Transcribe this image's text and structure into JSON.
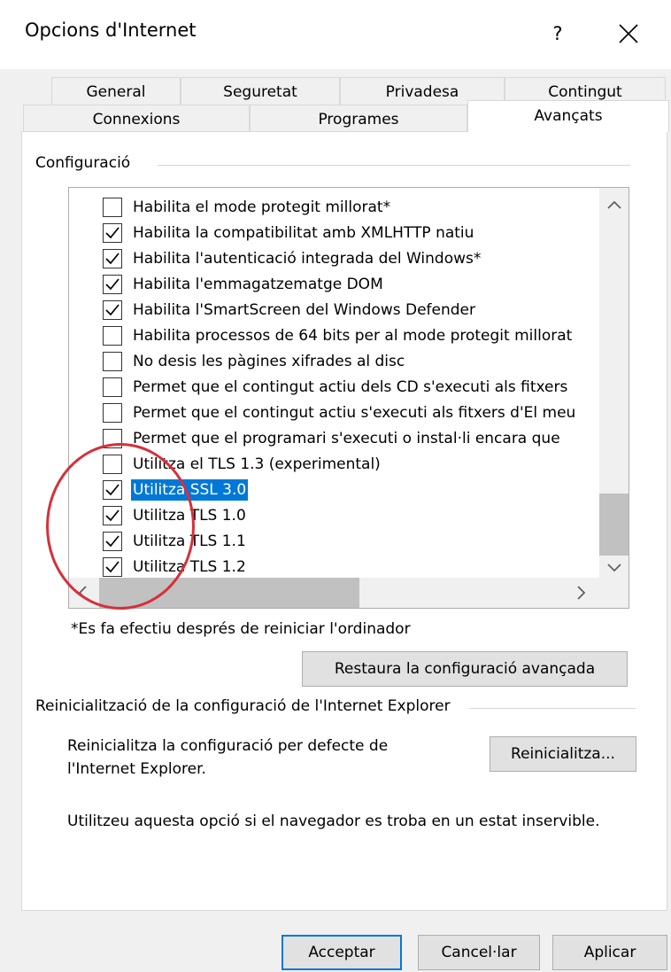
{
  "window": {
    "title": "Opcions d'Internet",
    "help": "?"
  },
  "tabs": {
    "row1": [
      "General",
      "Seguretat",
      "Privadesa",
      "Contingut"
    ],
    "row2": [
      "Connexions",
      "Programes",
      "Avançats"
    ],
    "selected": "Avançats"
  },
  "settings": {
    "group_label": "Configuració",
    "items": [
      {
        "label": "Habilita el mode protegit millorat*",
        "checked": false,
        "selected": false
      },
      {
        "label": "Habilita la compatibilitat amb XMLHTTP natiu",
        "checked": true,
        "selected": false
      },
      {
        "label": "Habilita l'autenticació integrada del Windows*",
        "checked": true,
        "selected": false
      },
      {
        "label": "Habilita l'emmagatzematge DOM",
        "checked": true,
        "selected": false
      },
      {
        "label": "Habilita l'SmartScreen del Windows Defender",
        "checked": true,
        "selected": false
      },
      {
        "label": "Habilita processos de 64 bits per al mode protegit millorat",
        "checked": false,
        "selected": false
      },
      {
        "label": "No desis les pàgines xifrades al disc",
        "checked": false,
        "selected": false
      },
      {
        "label": "Permet que el contingut actiu dels CD s'executi als fitxers",
        "checked": false,
        "selected": false
      },
      {
        "label": "Permet que el contingut actiu s'executi als fitxers d'El meu",
        "checked": false,
        "selected": false
      },
      {
        "label": "Permet que el programari s'executi o instal·li encara que",
        "checked": false,
        "selected": false
      },
      {
        "label": "Utilitza el TLS 1.3 (experimental)",
        "checked": false,
        "selected": false
      },
      {
        "label": "Utilitza SSL 3.0",
        "checked": true,
        "selected": true
      },
      {
        "label": "Utilitza TLS 1.0",
        "checked": true,
        "selected": false
      },
      {
        "label": "Utilitza TLS 1.1",
        "checked": true,
        "selected": false
      },
      {
        "label": "Utilitza TLS 1.2",
        "checked": true,
        "selected": false
      }
    ],
    "scroll_up": "^",
    "scroll_down": "v",
    "scroll_left": "<",
    "scroll_right": ">",
    "restart_note": "*Es fa efectiu després de reiniciar l'ordinador",
    "restore_button": "Restaura la configuració avançada"
  },
  "reset": {
    "group_label": "Reinicialització de la configuració de l'Internet Explorer",
    "description_line1": "Reinicialitza la configuració per defecte de",
    "description_line2": "l'Internet Explorer.",
    "reset_button": "Reinicialitza...",
    "warning": "Utilitzeu aquesta opció si el navegador es troba en un estat inservible."
  },
  "footer": {
    "ok": "Acceptar",
    "cancel": "Cancel·lar",
    "apply": "Aplicar"
  },
  "annotation": {
    "circle_color": "#d6303a"
  },
  "colors": {
    "selection": "#0078d7"
  }
}
